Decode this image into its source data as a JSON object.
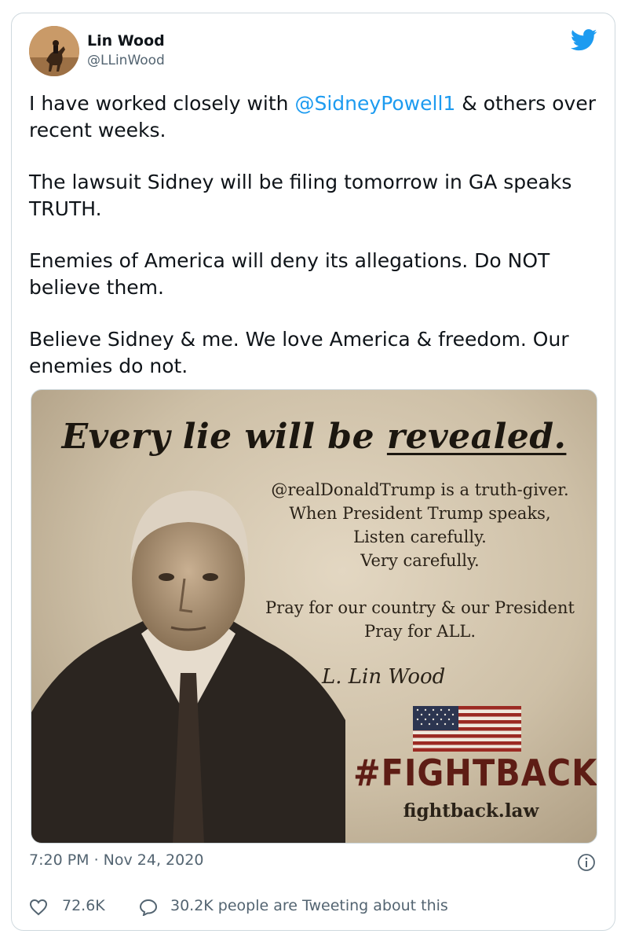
{
  "tweet": {
    "author": {
      "name": "Lin Wood",
      "handle": "@LLinWood"
    },
    "text": {
      "p1_before": "I have worked closely with ",
      "p1_mention": "@SidneyPowell1",
      "p1_after": " & others over recent weeks.",
      "p2": "The lawsuit Sidney will be filing tomorrow in GA speaks TRUTH.",
      "p3": "Enemies of America will deny its allegations. Do NOT believe them.",
      "p4": "Believe Sidney & me. We love America & freedom. Our enemies do not."
    },
    "image": {
      "headline_a": "Every lie will be ",
      "headline_b": "revealed.",
      "lines": [
        "@realDonaldTrump is a truth-giver.",
        "When President Trump speaks,",
        "Listen carefully.",
        "Very carefully."
      ],
      "prayer": [
        "Pray for our country & our President",
        "Pray for ALL."
      ],
      "signature": "L. Lin Wood",
      "hashtag": "#FIGHTBACK",
      "site": "fightback.law"
    },
    "timestamp": "7:20 PM · Nov 24, 2020",
    "likes": "72.6K",
    "talking": "30.2K people are Tweeting about this"
  },
  "colors": {
    "link": "#1d9bf0",
    "secondary_text": "#536471",
    "twitter_blue": "#1d9bf0"
  },
  "icons": [
    "twitter-logo-icon",
    "info-icon",
    "heart-icon",
    "reply-bubble-icon"
  ]
}
